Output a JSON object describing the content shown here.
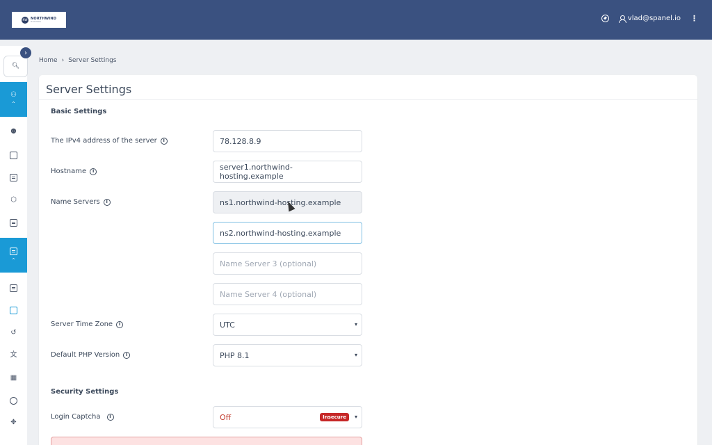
{
  "header": {
    "logo_text": "NORTHWIND",
    "logo_mark": "NW",
    "logo_sub": "HOSTING",
    "user_email": "vlad@spanel.io",
    "bg_color": "#3a5180"
  },
  "sidebar": {
    "accent": "#1a9ad6",
    "toggle_icon": "chevron-right-icon",
    "items": [
      {
        "icon": "search-icon"
      },
      {
        "icon": "users-group-icon",
        "active": true
      },
      {
        "icon": "user-accounts-icon"
      },
      {
        "icon": "calendar-icon"
      },
      {
        "icon": "terminal-icon"
      },
      {
        "icon": "package-icon"
      },
      {
        "icon": "server-card-icon"
      },
      {
        "icon": "server-icon",
        "active": true
      },
      {
        "icon": "document-icon"
      },
      {
        "icon": "settings-chip-icon"
      },
      {
        "icon": "history-icon"
      },
      {
        "icon": "translate-icon"
      },
      {
        "icon": "qr-code-icon"
      },
      {
        "icon": "shield-icon"
      },
      {
        "icon": "move-icon"
      }
    ]
  },
  "breadcrumb": {
    "home": "Home",
    "current": "Server Settings"
  },
  "page": {
    "title": "Server Settings",
    "basic_section": "Basic Settings",
    "security_section": "Security Settings",
    "fields": {
      "ipv4": {
        "label": "The IPv4 address of the server",
        "value": "78.128.8.9"
      },
      "hostname": {
        "label": "Hostname",
        "value": "server1.northwind-hosting.example"
      },
      "nameservers": {
        "label": "Name Servers",
        "ns1": "ns1.northwind-hosting.example",
        "ns2": "ns2.northwind-hosting.example",
        "ns3_placeholder": "Name Server 3 (optional)",
        "ns4_placeholder": "Name Server 4 (optional)"
      },
      "timezone": {
        "label": "Server Time Zone",
        "value": "UTC"
      },
      "php": {
        "label": "Default PHP Version",
        "value": "PHP 8.1"
      },
      "captcha": {
        "label": "Login Captcha",
        "value": "Off",
        "badge": "Insecure"
      }
    }
  }
}
